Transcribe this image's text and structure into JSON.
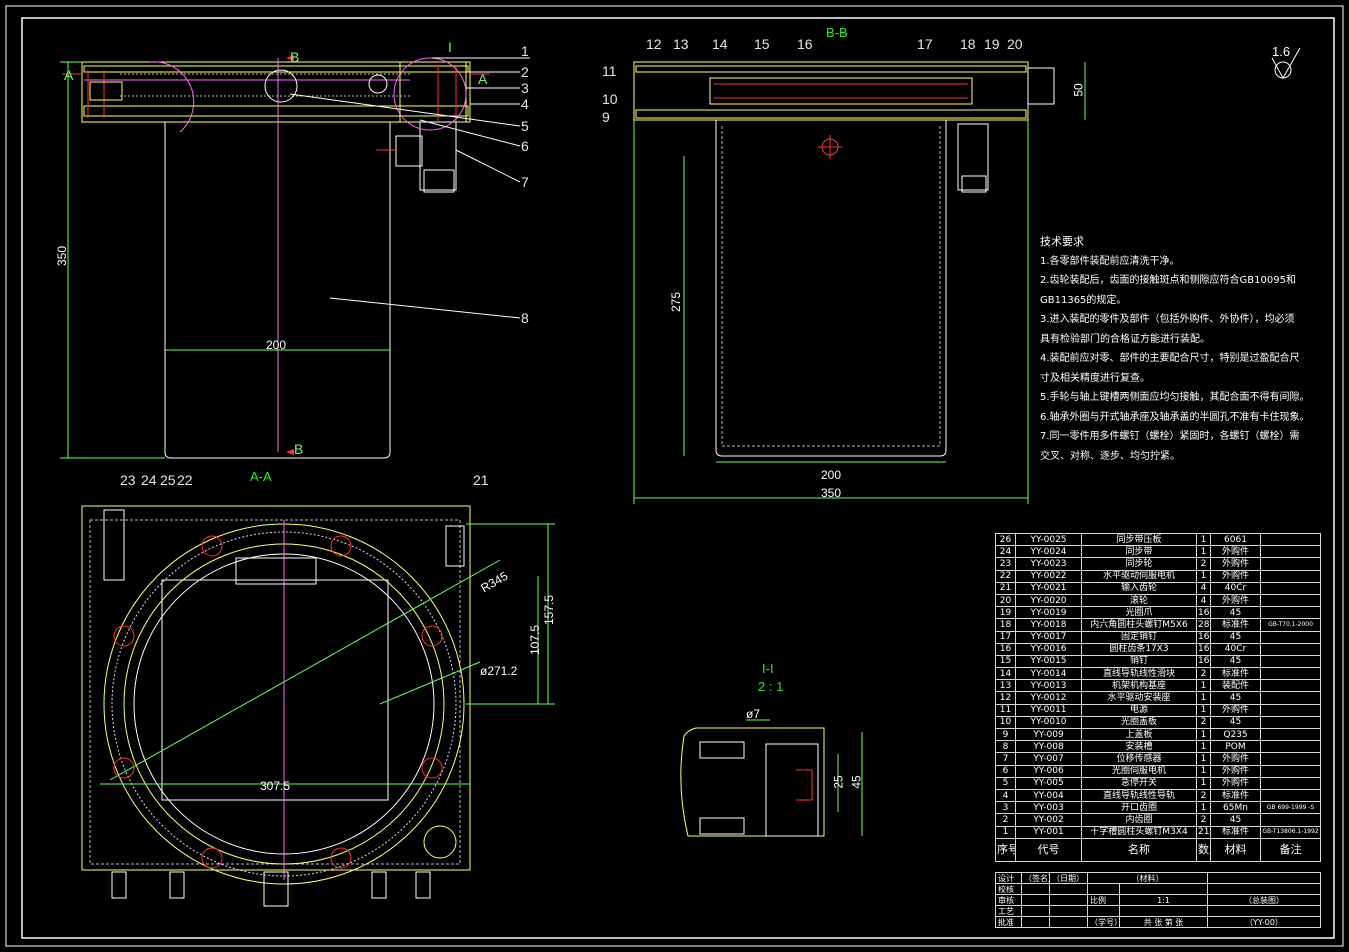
{
  "section_titles": {
    "bb": "B-B",
    "aa": "A-A",
    "detail": "I-I",
    "detail_scale": "2 : 1"
  },
  "cut_marks": {
    "a_left": "A",
    "a_right": "A",
    "b_top": "B",
    "b_bottom": "B",
    "detail_tag": "I"
  },
  "roughness": "1.6",
  "balloons_top_right": [
    "1",
    "2",
    "3",
    "4",
    "5",
    "6",
    "7",
    "8"
  ],
  "balloons_bb": [
    "11",
    "12",
    "13",
    "14",
    "15",
    "16",
    "17",
    "18",
    "19",
    "20",
    "10",
    "9"
  ],
  "balloons_aa": [
    "23",
    "24",
    "25",
    "22",
    "21"
  ],
  "dims": {
    "v350_left": "350",
    "h200_left": "200",
    "v50_bb": "50",
    "v275_bb": "275",
    "h200_bb": "200",
    "h350_bb": "350",
    "r345": "R345",
    "v157": "157.5",
    "v107": "107.5",
    "d271": "ø271.2",
    "h307": "307.5",
    "d7": "ø7",
    "v25": "25",
    "v45": "45"
  },
  "notes": {
    "title": "技术要求",
    "lines": [
      "1.各零部件装配前应清洗干净。",
      "2.齿轮装配后，齿面的接触斑点和侧隙应符合GB10095和",
      "  GB11365的规定。",
      "3.进入装配的零件及部件（包括外购件、外协件），均必须",
      "  具有检验部门的合格证方能进行装配。",
      "4.装配前应对零、部件的主要配合尺寸，特别是过盈配合尺",
      "  寸及相关精度进行复查。",
      "5.手轮与轴上键槽两侧面应均匀接触，其配合面不得有间隙。",
      "6.轴承外圈与开式轴承座及轴承盖的半圆孔不准有卡住现象。",
      "7.同一零件用多件螺钉（螺栓）紧固时，各螺钉（螺栓）需",
      "  交叉、对称、逐步、均匀拧紧。"
    ]
  },
  "bom": {
    "rows": [
      [
        "26",
        "YY-0025",
        "同步带压板",
        "1",
        "6061",
        ""
      ],
      [
        "24",
        "YY-0024",
        "同步带",
        "1",
        "外购件",
        ""
      ],
      [
        "23",
        "YY-0023",
        "同步轮",
        "2",
        "外购件",
        ""
      ],
      [
        "22",
        "YY-0022",
        "水平驱动伺服电机",
        "1",
        "外购件",
        ""
      ],
      [
        "21",
        "YY-0021",
        "输入齿轮",
        "4",
        "40Cr",
        ""
      ],
      [
        "20",
        "YY-0020",
        "滚轮",
        "4",
        "外购件",
        ""
      ],
      [
        "19",
        "YY-0019",
        "光圈爪",
        "16",
        "45",
        ""
      ],
      [
        "18",
        "YY-0018",
        "内六角圆柱头螺钉M5X6",
        "28",
        "标准件",
        "GB-T70.1-2000"
      ],
      [
        "17",
        "YY-0017",
        "固定销钉",
        "16",
        "45",
        ""
      ],
      [
        "16",
        "YY-0016",
        "圆柱齿条17X3",
        "16",
        "40Cr",
        ""
      ],
      [
        "15",
        "YY-0015",
        "销钉",
        "16",
        "45",
        ""
      ],
      [
        "14",
        "YY-0014",
        "直线导轨线性滑块",
        "2",
        "标准件",
        ""
      ],
      [
        "13",
        "YY-0013",
        "机架机构基座",
        "1",
        "装配件",
        ""
      ],
      [
        "12",
        "YY-0012",
        "水平驱动安装座",
        "1",
        "45",
        ""
      ],
      [
        "11",
        "YY-0011",
        "电源",
        "1",
        "外购件",
        ""
      ],
      [
        "10",
        "YY-0010",
        "光圈盖板",
        "2",
        "45",
        ""
      ],
      [
        "9",
        "YY-009",
        "上盖板",
        "1",
        "Q235",
        ""
      ],
      [
        "8",
        "YY-008",
        "安装槽",
        "1",
        "POM",
        ""
      ],
      [
        "7",
        "YY-007",
        "位移传感器",
        "1",
        "外购件",
        ""
      ],
      [
        "6",
        "YY-006",
        "光圈伺服电机",
        "1",
        "外购件",
        ""
      ],
      [
        "5",
        "YY-005",
        "急停开关",
        "1",
        "外购件",
        ""
      ],
      [
        "4",
        "YY-004",
        "直线导轨线性导轨",
        "2",
        "标准件",
        ""
      ],
      [
        "3",
        "YY-003",
        "开口齿圈",
        "1",
        "65Mn",
        "GB 699-1999 -S"
      ],
      [
        "2",
        "YY-002",
        "内齿圈",
        "2",
        "45",
        ""
      ],
      [
        "1",
        "YY-001",
        "十字槽圆柱头螺钉M3X4",
        "21",
        "标准件",
        "GB-T13806.1-1992"
      ]
    ],
    "header": [
      "序号",
      "代号",
      "名称",
      "数量",
      "材料",
      "备注"
    ]
  },
  "title_block": {
    "design": "设计",
    "sign": "（签名）",
    "date": "（日期）",
    "material": "（材料）",
    "check": "校核",
    "audit": "审核",
    "process": "工艺",
    "approve": "批准",
    "scale_label": "比例",
    "scale_value": "1:1",
    "drawing_name": "（总装图）",
    "sheets": "共 张  第 张",
    "school": "（学号）",
    "code": "（YY-00）"
  }
}
